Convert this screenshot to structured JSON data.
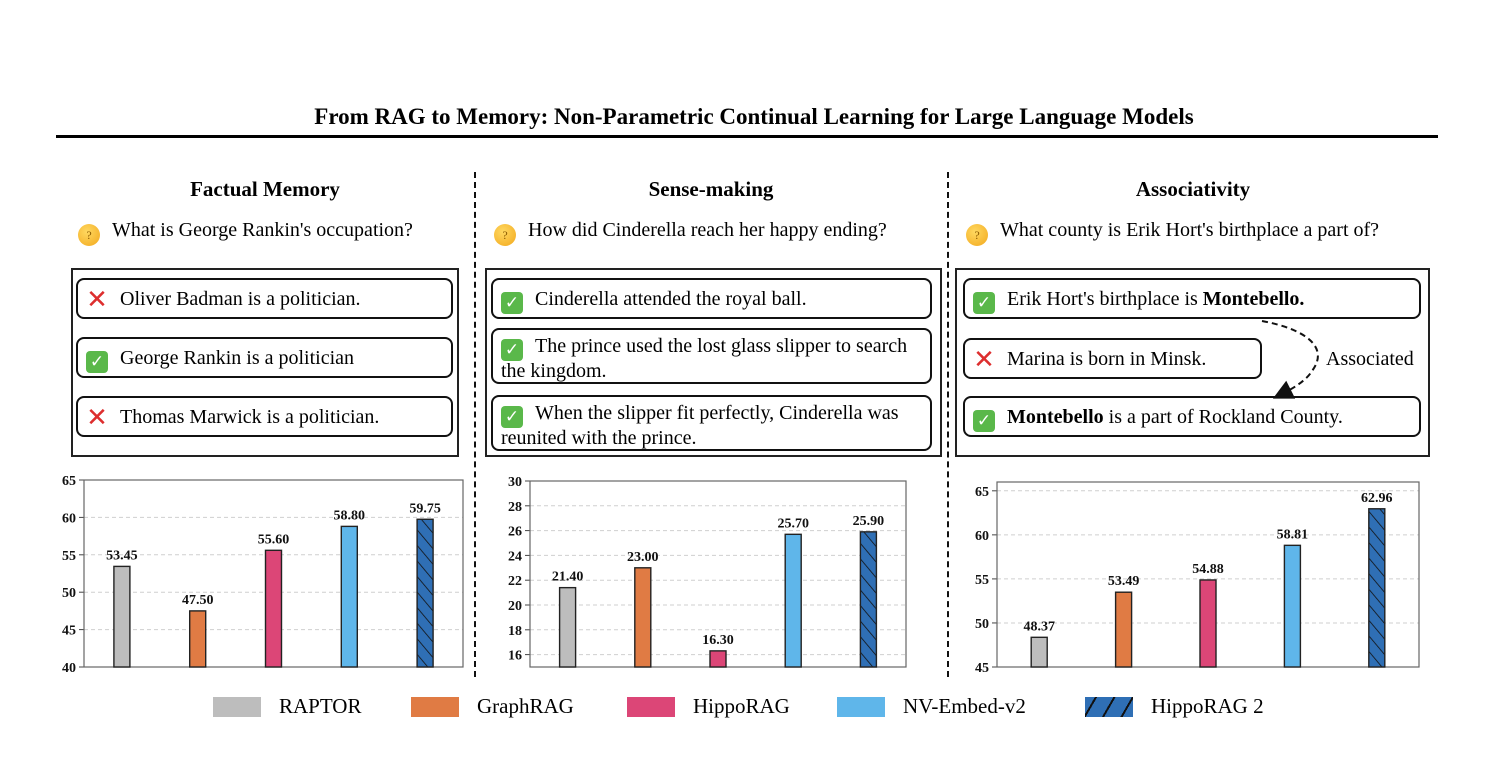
{
  "title": "From RAG to Memory: Non-Parametric Continual Learning for Large Language Models",
  "icons": {
    "question": "thinking-face-icon",
    "correct": "check-mark-icon",
    "incorrect": "cross-mark-icon"
  },
  "panels": [
    {
      "heading": "Factual Memory",
      "question": "What is George Rankin's occupation?",
      "passages": [
        {
          "status": "incorrect",
          "text": "Oliver Badman is a politician."
        },
        {
          "status": "correct",
          "text": "George Rankin is a politician"
        },
        {
          "status": "incorrect",
          "text": "Thomas Marwick is a politician."
        }
      ]
    },
    {
      "heading": "Sense-making",
      "question": "How did Cinderella reach her happy ending?",
      "passages": [
        {
          "status": "correct",
          "text": "Cinderella attended the royal ball."
        },
        {
          "status": "correct",
          "text": "The prince used the lost glass slipper to search the kingdom."
        },
        {
          "status": "correct",
          "text": "When the slipper fit perfectly, Cinderella was reunited with the prince."
        }
      ]
    },
    {
      "heading": "Associativity",
      "question": "What county is Erik Hort's birthplace a part of?",
      "passages": [
        {
          "status": "correct",
          "text_plain": "Erik Hort's birthplace is ",
          "text_bold": "Montebello."
        },
        {
          "status": "incorrect",
          "text": "Marina is born in Minsk."
        },
        {
          "status": "correct",
          "text_bold": "Montebello",
          "text_plain": " is a part of Rockland County."
        }
      ],
      "association_label": "Associated"
    }
  ],
  "legend": [
    {
      "name": "RAPTOR",
      "color": "#bdbdbd",
      "hatch": false
    },
    {
      "name": "GraphRAG",
      "color": "#e07b44",
      "hatch": false
    },
    {
      "name": "HippoRAG",
      "color": "#dc4677",
      "hatch": false
    },
    {
      "name": "NV-Embed-v2",
      "color": "#5fb6ea",
      "hatch": false
    },
    {
      "name": "HippoRAG 2",
      "color": "#2f6fb5",
      "hatch": true
    }
  ],
  "chart_data": [
    {
      "type": "bar",
      "title": "Factual Memory",
      "categories": [
        "RAPTOR",
        "GraphRAG",
        "HippoRAG",
        "NV-Embed-v2",
        "HippoRAG 2"
      ],
      "values": [
        53.45,
        47.5,
        55.6,
        58.8,
        59.75
      ],
      "labels": [
        "53.45",
        "47.50",
        "55.60",
        "58.80",
        "59.75"
      ],
      "ylim": [
        40,
        65
      ],
      "yticks": [
        40,
        45,
        50,
        55,
        60,
        65
      ],
      "grid": true,
      "xlabel": "",
      "ylabel": ""
    },
    {
      "type": "bar",
      "title": "Sense-making",
      "categories": [
        "RAPTOR",
        "GraphRAG",
        "HippoRAG",
        "NV-Embed-v2",
        "HippoRAG 2"
      ],
      "values": [
        21.4,
        23.0,
        16.3,
        25.7,
        25.9
      ],
      "labels": [
        "21.40",
        "23.00",
        "16.30",
        "25.70",
        "25.90"
      ],
      "ylim": [
        15,
        30
      ],
      "yticks": [
        16,
        18,
        20,
        22,
        24,
        26,
        28,
        30
      ],
      "grid": true,
      "xlabel": "",
      "ylabel": ""
    },
    {
      "type": "bar",
      "title": "Associativity",
      "categories": [
        "RAPTOR",
        "GraphRAG",
        "HippoRAG",
        "NV-Embed-v2",
        "HippoRAG 2"
      ],
      "values": [
        48.37,
        53.49,
        54.88,
        58.81,
        62.96
      ],
      "labels": [
        "48.37",
        "53.49",
        "54.88",
        "58.81",
        "62.96"
      ],
      "ylim": [
        45,
        66
      ],
      "yticks": [
        45,
        50,
        55,
        60,
        65
      ],
      "grid": true,
      "xlabel": "",
      "ylabel": ""
    }
  ]
}
